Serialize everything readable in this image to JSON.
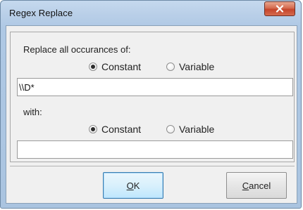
{
  "window": {
    "title": "Regex Replace"
  },
  "find_section": {
    "label": "Replace all occurances of:",
    "radio_constant": "Constant",
    "radio_variable": "Variable",
    "selected": "Constant",
    "value": "\\\\D*"
  },
  "replace_section": {
    "label": "with:",
    "radio_constant": "Constant",
    "radio_variable": "Variable",
    "selected": "Constant",
    "value": ""
  },
  "buttons": {
    "ok": {
      "mnemonic": "O",
      "rest": "K"
    },
    "cancel": {
      "mnemonic": "C",
      "rest": "ancel"
    }
  },
  "icons": {
    "close": "close-x-icon"
  },
  "colors": {
    "title_gradient_top": "#c5d9ee",
    "close_button": "#c5452b",
    "dialog_bg": "#f0f0f0",
    "default_button_border": "#3c7fb1"
  }
}
